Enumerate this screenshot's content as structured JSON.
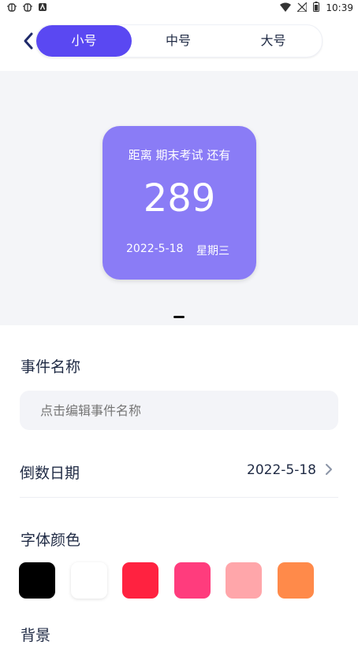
{
  "status_bar": {
    "time": "10:39"
  },
  "segmented": {
    "items": [
      "小号",
      "中号",
      "大号"
    ],
    "selected_index": 0
  },
  "widget": {
    "label": "距离 期末考试 还有",
    "days": "289",
    "date": "2022-5-18",
    "weekday": "星期三",
    "bg_color": "#8a7cf6"
  },
  "form": {
    "event_name_title": "事件名称",
    "event_name_placeholder": "点击编辑事件名称",
    "countdown_date_title": "倒数日期",
    "countdown_date_value": "2022-5-18",
    "font_color_title": "字体颜色",
    "font_colors": [
      "#000000",
      "#ffffff",
      "#ff2240",
      "#ff3c7d",
      "#ffa6aa",
      "#ff8a4a"
    ],
    "background_title_partial": "背景"
  },
  "accent_color": "#5a48f2"
}
